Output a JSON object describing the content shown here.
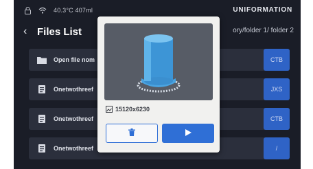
{
  "status": {
    "temperature": "40.3°C 407ml",
    "brand": "UNIFORMATION"
  },
  "header": {
    "title": "Files List",
    "path": "ory/folder 1/ folder 2"
  },
  "files": [
    {
      "name": "Open file nom",
      "type": "CTB",
      "icon": "folder-icon"
    },
    {
      "name": "Onetwothreef",
      "type": "JXS",
      "icon": "file-icon"
    },
    {
      "name": "Onetwothreef",
      "type": "CTB",
      "icon": "file-icon"
    },
    {
      "name": "Onetwothreef",
      "type": "/",
      "icon": "file-icon"
    }
  ],
  "modal": {
    "resolution": "15120x6230",
    "delete_icon": "trash-icon",
    "print_icon": "play-icon"
  },
  "colors": {
    "background": "#1a1d27",
    "row": "#2b2f3c",
    "accent": "#2f6fd6",
    "model": "#3d95d6"
  }
}
